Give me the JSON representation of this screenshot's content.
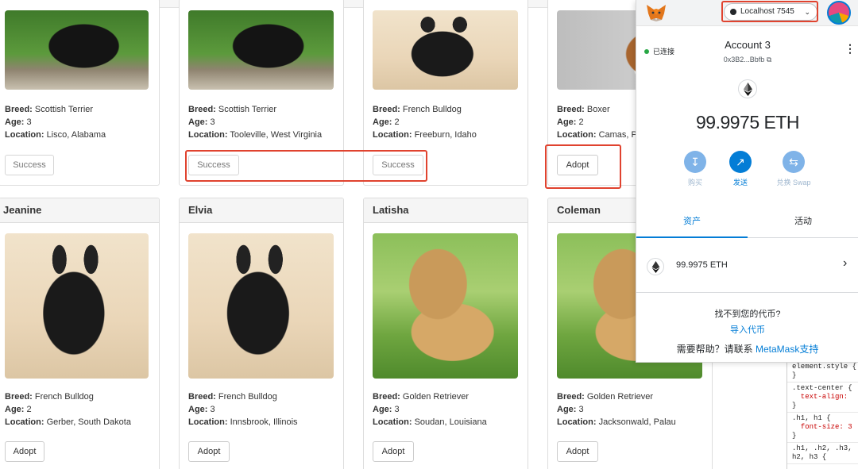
{
  "bookmarks": [
    "",
    "",
    "",
    "",
    "",
    ""
  ],
  "pets_top": [
    {
      "name": "",
      "breed": "Scottish Terrier",
      "age": "3",
      "location": "Lisco, Alabama",
      "button": "Success",
      "img": "black-dog"
    },
    {
      "name": "",
      "breed": "Scottish Terrier",
      "age": "3",
      "location": "Tooleville, West Virginia",
      "button": "Success",
      "img": "black-dog"
    },
    {
      "name": "",
      "breed": "French Bulldog",
      "age": "2",
      "location": "Freeburn, Idaho",
      "button": "Success",
      "img": "frenchie"
    },
    {
      "name": "",
      "breed": "Boxer",
      "age": "2",
      "location": "Camas, P",
      "button": "Adopt",
      "img": "boxer"
    }
  ],
  "pets_bottom": [
    {
      "name": "Jeanine",
      "breed": "French Bulldog",
      "age": "2",
      "location": "Gerber, South Dakota",
      "button": "Adopt",
      "img": "frenchie"
    },
    {
      "name": "Elvia",
      "breed": "French Bulldog",
      "age": "3",
      "location": "Innsbrook, Illinois",
      "button": "Adopt",
      "img": "frenchie"
    },
    {
      "name": "Latisha",
      "breed": "Golden Retriever",
      "age": "3",
      "location": "Soudan, Louisiana",
      "button": "Adopt",
      "img": "golden"
    },
    {
      "name": "Coleman",
      "breed": "Golden Retriever",
      "age": "3",
      "location": "Jacksonwald, Palau",
      "button": "Adopt",
      "img": "golden"
    }
  ],
  "labels": {
    "breed": "Breed:",
    "age": "Age:",
    "location": "Location:"
  },
  "metamask": {
    "network": "Localhost 7545",
    "connected": "已连接",
    "account_name": "Account 3",
    "account_address": "0x3B2...Bbfb",
    "balance": "99.9975 ETH",
    "actions": [
      {
        "label": "购买",
        "icon": "download-icon"
      },
      {
        "label": "发送",
        "icon": "send-arrow-icon"
      },
      {
        "label": "兑换 Swap",
        "icon": "swap-icon"
      }
    ],
    "tabs": [
      "资产",
      "活动"
    ],
    "asset_value": "99.9975 ETH",
    "no_token": "找不到您的代币?",
    "import_token": "导入代币",
    "need_help": "需要帮助？请联系",
    "support": "MetaMask支持"
  },
  "colors": {
    "accent": "#037dd6",
    "highlight": "#e0432f"
  },
  "devtools": [
    {
      "selector": "element.style {",
      "prop": "",
      "end": "}"
    },
    {
      "selector": ".text-center {",
      "prop": "  text-align:",
      "end": "}"
    },
    {
      "selector": ".h1, h1 {",
      "prop": "  font-size: 3",
      "end": "}"
    },
    {
      "selector": ".h1, .h2, .h3,",
      "prop": "h2, h3 {",
      "end": ""
    }
  ]
}
